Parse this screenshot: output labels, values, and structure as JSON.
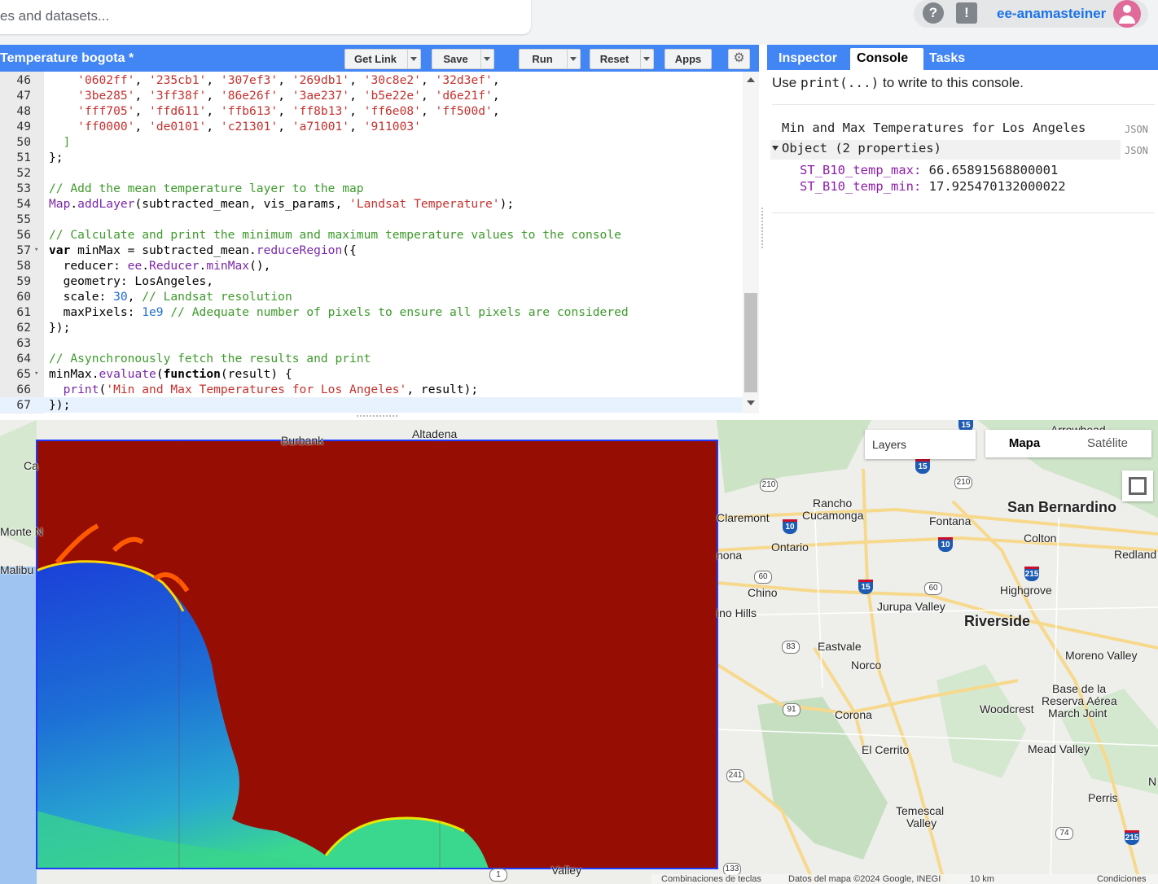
{
  "search": {
    "placeholder_text": "es and datasets..."
  },
  "account": {
    "username": "ee-anamasteiner",
    "help_icon": "?",
    "feedback_icon": "!"
  },
  "editor": {
    "title": "Temperature bogota *",
    "buttons": {
      "get_link": "Get Link",
      "save": "Save",
      "run": "Run",
      "reset": "Reset",
      "apps": "Apps"
    },
    "settings_icon": "⚙"
  },
  "code_lines": [
    {
      "n": "46",
      "fold": "",
      "html": "    <span class='s'>'0602ff'</span>, <span class='s'>'235cb1'</span>, <span class='s'>'307ef3'</span>, <span class='s'>'269db1'</span>, <span class='s'>'30c8e2'</span>, <span class='s'>'32d3ef'</span>,"
    },
    {
      "n": "47",
      "fold": "",
      "html": "    <span class='s'>'3be285'</span>, <span class='s'>'3ff38f'</span>, <span class='s'>'86e26f'</span>, <span class='s'>'3ae237'</span>, <span class='s'>'b5e22e'</span>, <span class='s'>'d6e21f'</span>,"
    },
    {
      "n": "48",
      "fold": "",
      "html": "    <span class='s'>'fff705'</span>, <span class='s'>'ffd611'</span>, <span class='s'>'ffb613'</span>, <span class='s'>'ff8b13'</span>, <span class='s'>'ff6e08'</span>, <span class='s'>'ff500d'</span>,"
    },
    {
      "n": "49",
      "fold": "",
      "html": "    <span class='s'>'ff0000'</span>, <span class='s'>'de0101'</span>, <span class='s'>'c21301'</span>, <span class='s'>'a71001'</span>, <span class='s'>'911003'</span>"
    },
    {
      "n": "50",
      "fold": "",
      "html": "  <span class='c'>]</span>"
    },
    {
      "n": "51",
      "fold": "",
      "html": "};"
    },
    {
      "n": "52",
      "fold": "",
      "html": ""
    },
    {
      "n": "53",
      "fold": "",
      "html": "<span class='c'>// Add the mean temperature layer to the map</span>"
    },
    {
      "n": "54",
      "fold": "",
      "html": "<span class='p'>Map</span>.<span class='p'>addLayer</span>(subtracted_mean, vis_params, <span class='s'>'Landsat Temperature'</span>);"
    },
    {
      "n": "55",
      "fold": "",
      "html": ""
    },
    {
      "n": "56",
      "fold": "",
      "html": "<span class='c'>// Calculate and print the minimum and maximum temperature values to the console</span>"
    },
    {
      "n": "57",
      "fold": "▾",
      "html": "<span class='k'>var</span> minMax = subtracted_mean.<span class='p'>reduceRegion</span>({"
    },
    {
      "n": "58",
      "fold": "",
      "html": "  reducer: <span class='p'>ee</span>.<span class='p'>Reducer</span>.<span class='p'>minMax</span>(),"
    },
    {
      "n": "59",
      "fold": "",
      "html": "  geometry: LosAngeles,"
    },
    {
      "n": "60",
      "fold": "",
      "html": "  scale: <span class='n'>30</span>, <span class='c'>// Landsat resolution</span>"
    },
    {
      "n": "61",
      "fold": "",
      "html": "  maxPixels: <span class='n'>1e9</span> <span class='c'>// Adequate number of pixels to ensure all pixels are considered</span>"
    },
    {
      "n": "62",
      "fold": "",
      "html": "});"
    },
    {
      "n": "63",
      "fold": "",
      "html": ""
    },
    {
      "n": "64",
      "fold": "",
      "html": "<span class='c'>// Asynchronously fetch the results and print</span>"
    },
    {
      "n": "65",
      "fold": "▾",
      "html": "minMax.<span class='p'>evaluate</span>(<span class='k'>function</span>(result) {"
    },
    {
      "n": "66",
      "fold": "",
      "html": "  <span class='p'>print</span>(<span class='s'>'Min and Max Temperatures for Los Angeles'</span>, result);"
    },
    {
      "n": "67",
      "fold": "",
      "html": "});"
    }
  ],
  "right_panel": {
    "tabs": [
      "Inspector",
      "Console",
      "Tasks"
    ],
    "active_tab": "Console",
    "hint_prefix": "Use ",
    "hint_code": "print(...)",
    "hint_suffix": " to write to this console.",
    "output_label": "Min and Max Temperatures for Los Angeles",
    "object_label": "Object (2 properties)",
    "json_tag": "JSON",
    "properties": [
      {
        "key": "ST_B10_temp_max:",
        "value": "66.65891568800001"
      },
      {
        "key": "ST_B10_temp_min:",
        "value": "17.925470132000022"
      }
    ]
  },
  "map": {
    "layers_label": "Layers",
    "map_type_options": [
      "Mapa",
      "Satélite"
    ],
    "selected_map_type": "Mapa",
    "place_labels": [
      {
        "t": "Altadena",
        "big": false
      },
      {
        "t": "Rancho",
        "big": false
      },
      {
        "t": "Cucamonga",
        "big": false
      },
      {
        "t": "Claremont",
        "big": false
      },
      {
        "t": "Fontana",
        "big": false
      },
      {
        "t": "San Bernardino",
        "big": true
      },
      {
        "t": "Colton",
        "big": false
      },
      {
        "t": "Redland",
        "big": false
      },
      {
        "t": "Ontario",
        "big": false
      },
      {
        "t": "nona",
        "big": false
      },
      {
        "t": "Chino",
        "big": false
      },
      {
        "t": "ino Hills",
        "big": false
      },
      {
        "t": "Highgrove",
        "big": false
      },
      {
        "t": "Jurupa Valley",
        "big": false
      },
      {
        "t": "Riverside",
        "big": true
      },
      {
        "t": "Eastvale",
        "big": false
      },
      {
        "t": "Norco",
        "big": false
      },
      {
        "t": "Moreno Valley",
        "big": false
      },
      {
        "t": "Base de la",
        "big": false
      },
      {
        "t": "Reserva Aérea",
        "big": false
      },
      {
        "t": "March Joint",
        "big": false
      },
      {
        "t": "Woodcrest",
        "big": false
      },
      {
        "t": "Corona",
        "big": false
      },
      {
        "t": "El Cerrito",
        "big": false
      },
      {
        "t": "Mead Valley",
        "big": false
      },
      {
        "t": "Perris",
        "big": false
      },
      {
        "t": "Temescal",
        "big": false
      },
      {
        "t": "Valley",
        "big": false
      },
      {
        "t": "Ca",
        "big": false
      },
      {
        "t": "Monte N",
        "big": false
      },
      {
        "t": "Malibu",
        "big": false
      },
      {
        "t": "Valley",
        "big": false
      },
      {
        "t": "N",
        "big": false
      },
      {
        "t": "Arrowhead",
        "big": false
      },
      {
        "t": "Burbank",
        "big": false
      }
    ],
    "route_shields": [
      "15",
      "210",
      "210",
      "10",
      "10",
      "215",
      "60",
      "15",
      "60",
      "83",
      "91",
      "241",
      "74",
      "215",
      "133",
      "1",
      "15"
    ],
    "attribution": [
      "Combinaciones de teclas",
      "Datos del mapa ©2024 Google, INEGI",
      "10 km",
      "Condiciones"
    ]
  }
}
